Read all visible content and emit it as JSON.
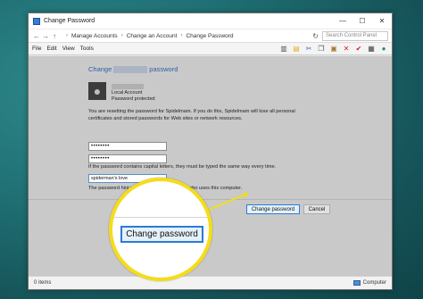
{
  "window": {
    "title": "Change Password",
    "controls": {
      "minimize": "—",
      "maximize": "☐",
      "close": "✕"
    }
  },
  "addressbar": {
    "crumbs": [
      "Manage Accounts",
      "Change an Account",
      "Change Password"
    ],
    "search_placeholder": "Search Control Panel"
  },
  "menubar": {
    "items": [
      "File",
      "Edit",
      "View",
      "Tools"
    ]
  },
  "content": {
    "heading_prefix": "Change",
    "heading_suffix": "password",
    "account_type": "Local Account",
    "account_status": "Password protected",
    "warning": "You are resetting the password for Spidelmam. If you do this, Spidelmam will lose all personal certificates and stored passwords for Web sites or network resources.",
    "new_password": "••••••••",
    "confirm_password": "••••••••",
    "case_note": "If the password contains capital letters, they must be typed the same way every time.",
    "hint_value": "spiderman's love",
    "hint_note": "The password hint will be visible to everyone who uses this computer.",
    "change_button": "Change password",
    "cancel_button": "Cancel"
  },
  "statusbar": {
    "items": "0 items",
    "location": "Computer"
  },
  "magnifier": {
    "button_label": "Change password"
  },
  "colors": {
    "accent": "#2a7bd6",
    "highlight": "#f5dc19",
    "heading": "#2e5ea8"
  }
}
